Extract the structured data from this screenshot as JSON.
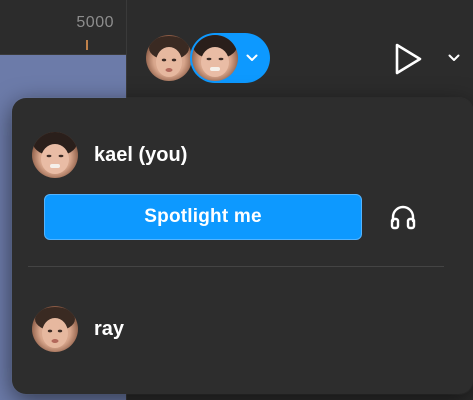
{
  "ruler": {
    "label": "5000"
  },
  "toolbar": {
    "collaborators": [
      {
        "icon": "avatar"
      },
      {
        "icon": "avatar",
        "selected": true
      }
    ],
    "multiplayer_chevron": "chevron-down-icon",
    "present": "play-icon",
    "present_options": "chevron-down-icon"
  },
  "popover": {
    "current_user": {
      "name": "kael (you)"
    },
    "spotlight_label": "Spotlight me",
    "audio": "headphones-icon",
    "other_users": [
      {
        "name": "ray"
      }
    ]
  },
  "colors": {
    "accent": "#0d99ff",
    "popover_bg": "#2d2d2d",
    "canvas_frame": "#6c7ba9"
  }
}
